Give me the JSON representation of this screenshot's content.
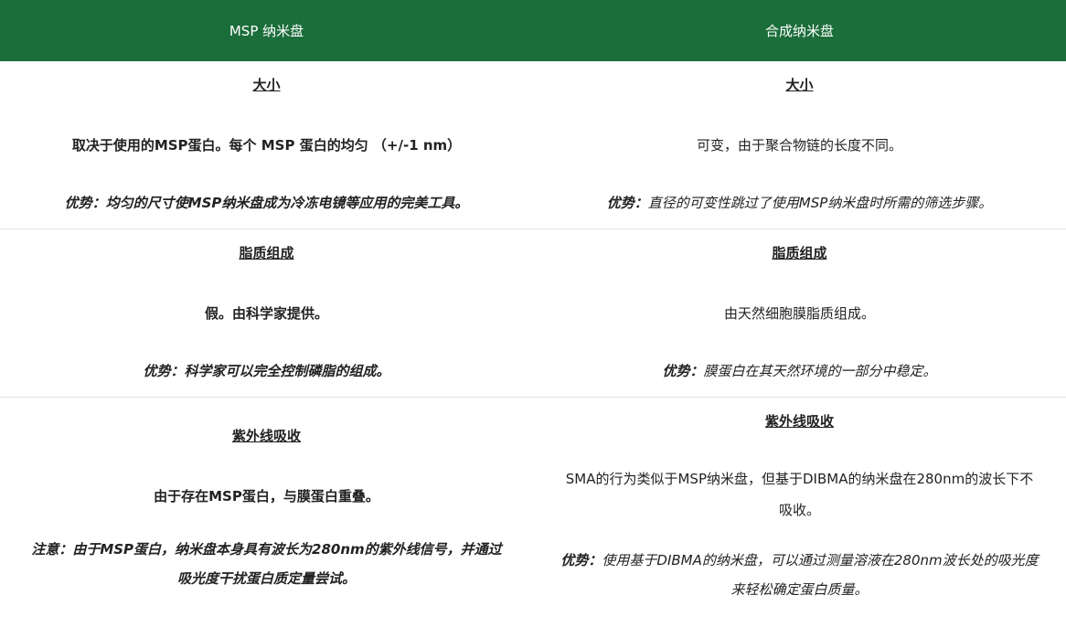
{
  "header": {
    "col_left": "MSP 纳米盘",
    "col_right": "合成纳米盘"
  },
  "rows": [
    {
      "left": {
        "title": "大小",
        "body": "取决于使用的MSP蛋白。每个 MSP 蛋白的均匀 （+/-1 nm）",
        "note_label": "优势：",
        "note_text": "均匀的尺寸使MSP纳米盘成为冷冻电镜等应用的完美工具。"
      },
      "right": {
        "title": "大小",
        "body": "可变，由于聚合物链的长度不同。",
        "note_label": "优势：",
        "note_text": "直径的可变性跳过了使用MSP纳米盘时所需的筛选步骤。"
      }
    },
    {
      "left": {
        "title": "脂质组成",
        "body": "假。由科学家提供。",
        "note_label": "优势：",
        "note_text": "科学家可以完全控制磷脂的组成。"
      },
      "right": {
        "title": "脂质组成",
        "body": "由天然细胞膜脂质组成。",
        "note_label": "优势：",
        "note_text": "膜蛋白在其天然环境的一部分中稳定。"
      }
    },
    {
      "left": {
        "title": "紫外线吸收",
        "body": "由于存在MSP蛋白，与膜蛋白重叠。",
        "note_label": "注意：",
        "note_text": "由于MSP蛋白，纳米盘本身具有波长为280nm的紫外线信号，并通过吸光度干扰蛋白质定量尝试。"
      },
      "right": {
        "title": "紫外线吸收",
        "body": "SMA的行为类似于MSP纳米盘，但基于DIBMA的纳米盘在280nm的波长下不吸收。",
        "note_label": "优势：",
        "note_text": "使用基于DIBMA的纳米盘，可以通过测量溶液在280nm波长处的吸光度来轻松确定蛋白质量。"
      }
    }
  ],
  "colors": {
    "header_bg": "#1b6d3a",
    "header_text": "#ffffff",
    "row_border": "#e3e3e3"
  }
}
